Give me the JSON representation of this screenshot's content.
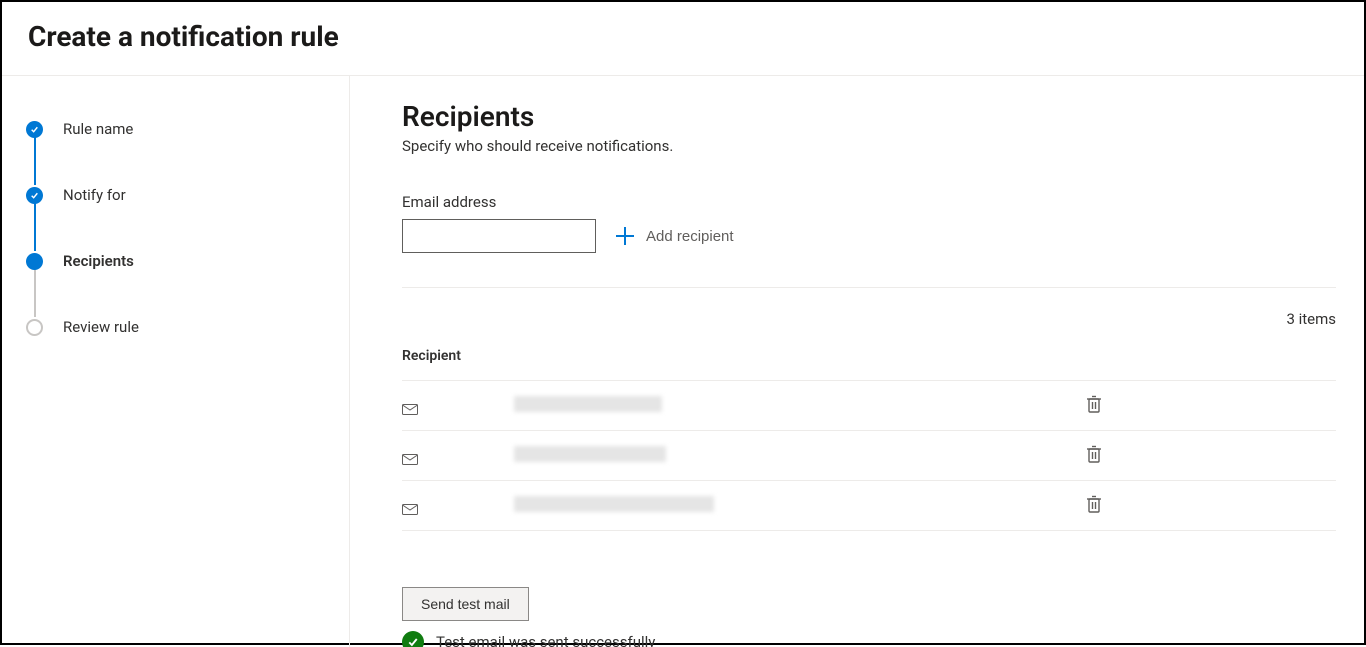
{
  "header": {
    "title": "Create a notification rule"
  },
  "steps": [
    {
      "label": "Rule name",
      "state": "done"
    },
    {
      "label": "Notify for",
      "state": "done"
    },
    {
      "label": "Recipients",
      "state": "current"
    },
    {
      "label": "Review rule",
      "state": "future"
    }
  ],
  "content": {
    "title": "Recipients",
    "subtitle": "Specify who should receive notifications.",
    "emailLabel": "Email address",
    "addRecipientLabel": "Add recipient",
    "itemsCount": "3 items",
    "tableHeader": "Recipient",
    "recipients": [
      {
        "email": "",
        "redactedWidth": 148
      },
      {
        "email": "",
        "redactedWidth": 152
      },
      {
        "email": "",
        "redactedWidth": 200
      }
    ],
    "sendTestLabel": "Send test mail",
    "statusMessage": "Test email was sent successfully"
  }
}
